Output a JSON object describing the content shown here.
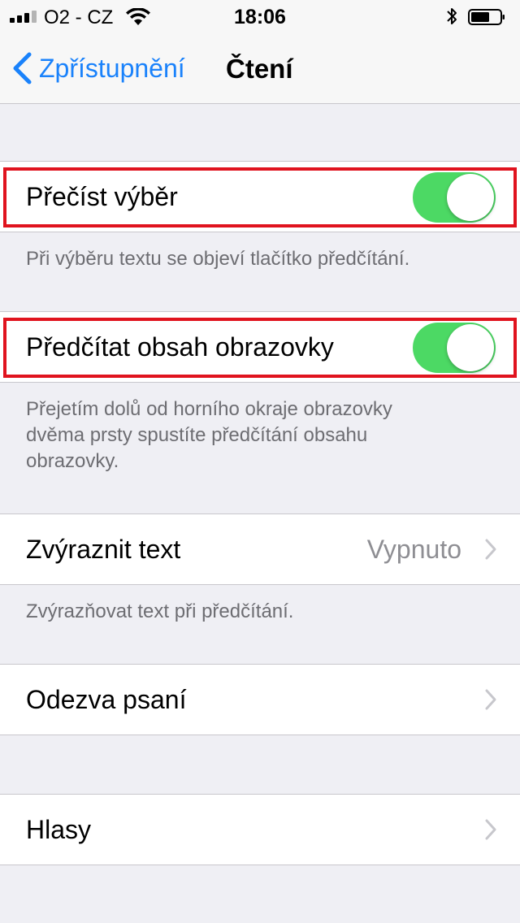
{
  "status_bar": {
    "carrier": "O2 - CZ",
    "time": "18:06",
    "signal_bars_filled": 3,
    "signal_bars_total": 4
  },
  "nav": {
    "back_label": "Zpřístupnění",
    "title": "Čtení"
  },
  "settings": {
    "speak_selection": {
      "label": "Přečíst výběr",
      "enabled": true,
      "footer": "Při výběru textu se objeví tlačítko předčítání."
    },
    "speak_screen": {
      "label": "Předčítat obsah obrazovky",
      "enabled": true,
      "footer_lines": [
        "Přejetím dolů od horního okraje obrazovky",
        "dvěma prsty spustíte předčítání obsahu",
        "obrazovky."
      ]
    },
    "highlight_content": {
      "label": "Zvýraznit text",
      "value": "Vypnuto",
      "footer": "Zvýrazňovat text při předčítání."
    },
    "typing_feedback": {
      "label": "Odezva psaní"
    },
    "voices": {
      "label": "Hlasy"
    }
  },
  "colors": {
    "accent": "#1a82fb",
    "toggle_on": "#4cd964",
    "highlight_border": "#e0131e",
    "background": "#efeff4"
  }
}
